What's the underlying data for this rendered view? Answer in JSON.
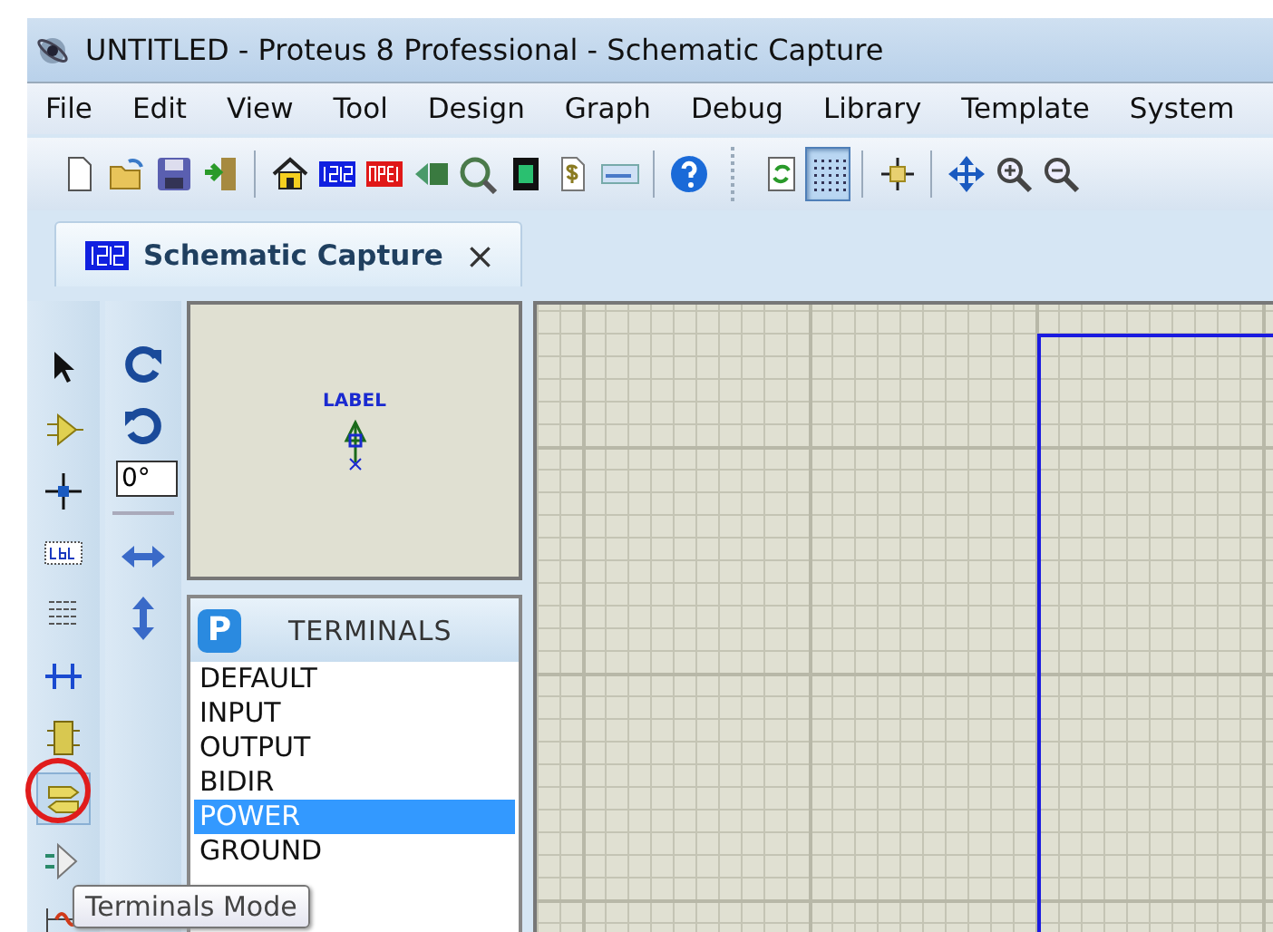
{
  "window": {
    "title": "UNTITLED - Proteus 8 Professional - Schematic Capture"
  },
  "menu": [
    "File",
    "Edit",
    "View",
    "Tool",
    "Design",
    "Graph",
    "Debug",
    "Library",
    "Template",
    "System"
  ],
  "toolbar": [
    {
      "kind": "new",
      "pressed": false
    },
    {
      "kind": "open",
      "pressed": false
    },
    {
      "kind": "save",
      "pressed": false
    },
    {
      "kind": "import",
      "pressed": false
    },
    {
      "kind": "sep"
    },
    {
      "kind": "home",
      "pressed": false
    },
    {
      "kind": "isis",
      "pressed": false
    },
    {
      "kind": "ares",
      "pressed": false
    },
    {
      "kind": "viewer3d",
      "pressed": false
    },
    {
      "kind": "gerber",
      "pressed": false
    },
    {
      "kind": "board",
      "pressed": false
    },
    {
      "kind": "dollar",
      "pressed": false
    },
    {
      "kind": "window",
      "pressed": false
    },
    {
      "kind": "sep"
    },
    {
      "kind": "help",
      "pressed": false
    },
    {
      "kind": "grip"
    },
    {
      "kind": "refresh",
      "pressed": false
    },
    {
      "kind": "grid",
      "pressed": true
    },
    {
      "kind": "sep"
    },
    {
      "kind": "origin",
      "pressed": false
    },
    {
      "kind": "sep"
    },
    {
      "kind": "pan",
      "pressed": false
    },
    {
      "kind": "zoomin",
      "pressed": false
    },
    {
      "kind": "zoomout",
      "pressed": false
    }
  ],
  "tab": {
    "label": "Schematic Capture",
    "selected": true,
    "close_glyph": "×"
  },
  "mode_tools": [
    {
      "kind": "select",
      "selected": false,
      "circled": false
    },
    {
      "kind": "component",
      "selected": false,
      "circled": false
    },
    {
      "kind": "junction",
      "selected": false,
      "circled": false
    },
    {
      "kind": "label",
      "selected": false,
      "circled": false
    },
    {
      "kind": "script",
      "selected": false,
      "circled": false
    },
    {
      "kind": "bus",
      "selected": false,
      "circled": false
    },
    {
      "kind": "subcircuit",
      "selected": false,
      "circled": false
    },
    {
      "kind": "terminal",
      "selected": true,
      "circled": true
    },
    {
      "kind": "port",
      "selected": false,
      "circled": false
    },
    {
      "kind": "generator",
      "selected": false,
      "circled": false
    }
  ],
  "rotation": {
    "value": "0°"
  },
  "preview": {
    "label": "LABEL"
  },
  "object_selector": {
    "badge": "P",
    "title": "TERMINALS",
    "items": [
      {
        "label": "DEFAULT",
        "selected": false
      },
      {
        "label": "INPUT",
        "selected": false
      },
      {
        "label": "OUTPUT",
        "selected": false
      },
      {
        "label": "BIDIR",
        "selected": false
      },
      {
        "label": "POWER",
        "selected": true
      },
      {
        "label": "GROUND",
        "selected": false
      }
    ]
  },
  "tooltip": {
    "text": "Terminals Mode"
  }
}
